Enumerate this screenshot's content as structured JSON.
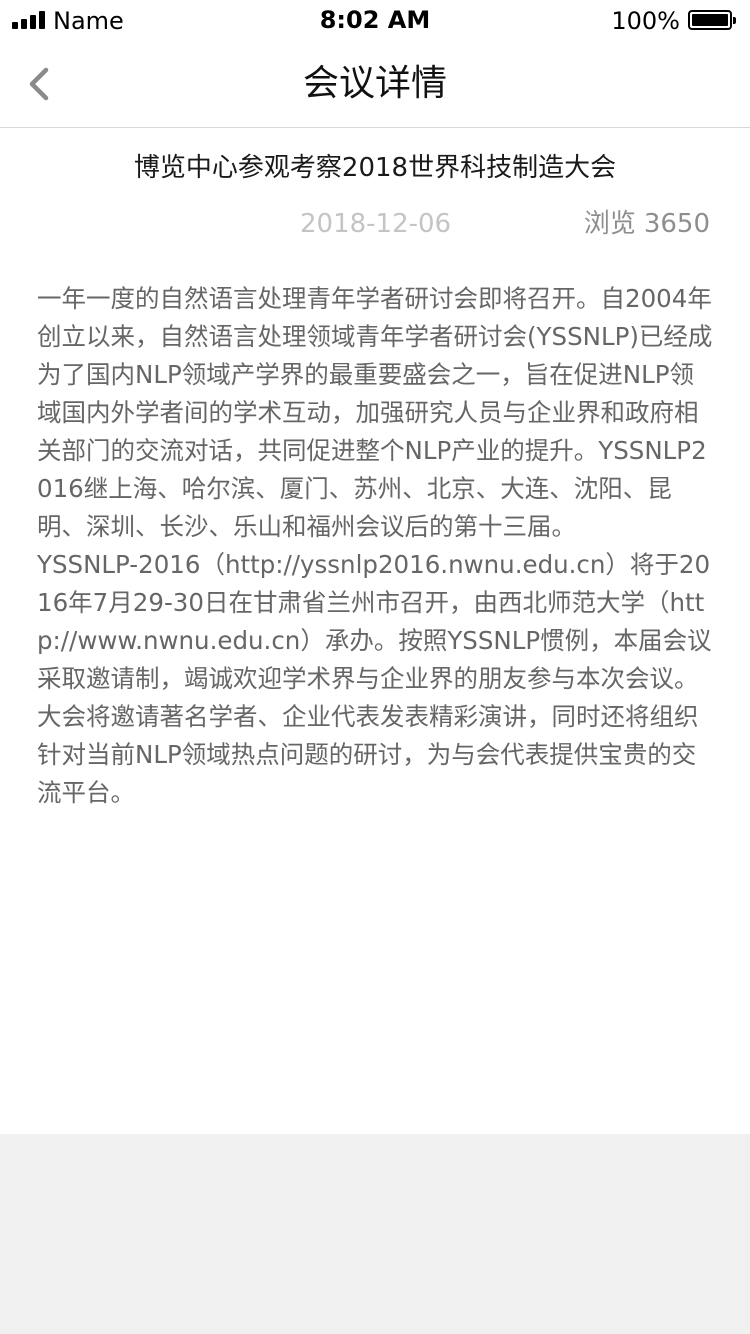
{
  "status_bar": {
    "carrier": "Name",
    "time": "8:02 AM",
    "battery_percent": "100%"
  },
  "nav": {
    "back_icon": "chevron-left-icon",
    "title": "会议详情"
  },
  "article": {
    "title": "博览中心参观考察2018世界科技制造大会",
    "date": "2018-12-06",
    "views_label": "浏览",
    "views_count": "3650",
    "paragraphs": [
      " 一年一度的自然语言处理青年学者研讨会即将召开。自2004年创立以来，自然语言处理领域青年学者研讨会(YSSNLP)已经成为了国内NLP领域产学界的最重要盛会之一，旨在促进NLP领域国内外学者间的学术互动，加强研究人员与企业界和政府相关部门的交流对话，共同促进整个NLP产业的提升。YSSNLP2016继上海、哈尔滨、厦门、苏州、北京、大连、沈阳、昆明、深圳、长沙、乐山和福州会议后的第十三届。",
      "YSSNLP-2016（http://yssnlp2016.nwnu.edu.cn）将于2016年7月29-30日在甘肃省兰州市召开，由西北师范大学（http://www.nwnu.edu.cn）承办。按照YSSNLP惯例，本届会议采取邀请制，竭诚欢迎学术界与企业界的朋友参与本次会议。大会将邀请著名学者、企业代表发表精彩演讲，同时还将组织针对当前NLP领域热点问题的研讨，为与会代表提供宝贵的交流平台。"
    ]
  },
  "colors": {
    "body_text": "#666666",
    "date_text": "#c4c4c4",
    "views_text": "#8e8e8e",
    "footer_bg": "#f0f0f0"
  }
}
